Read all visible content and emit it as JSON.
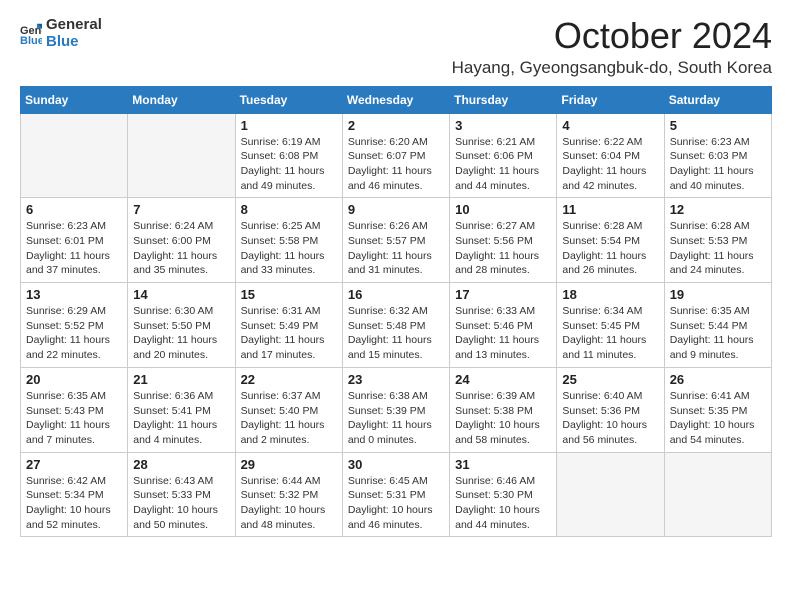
{
  "header": {
    "logo_general": "General",
    "logo_blue": "Blue",
    "title": "October 2024",
    "subtitle": "Hayang, Gyeongsangbuk-do, South Korea"
  },
  "days_of_week": [
    "Sunday",
    "Monday",
    "Tuesday",
    "Wednesday",
    "Thursday",
    "Friday",
    "Saturday"
  ],
  "weeks": [
    [
      {
        "day": "",
        "empty": true
      },
      {
        "day": "",
        "empty": true
      },
      {
        "day": "1",
        "sunrise": "Sunrise: 6:19 AM",
        "sunset": "Sunset: 6:08 PM",
        "daylight": "Daylight: 11 hours and 49 minutes."
      },
      {
        "day": "2",
        "sunrise": "Sunrise: 6:20 AM",
        "sunset": "Sunset: 6:07 PM",
        "daylight": "Daylight: 11 hours and 46 minutes."
      },
      {
        "day": "3",
        "sunrise": "Sunrise: 6:21 AM",
        "sunset": "Sunset: 6:06 PM",
        "daylight": "Daylight: 11 hours and 44 minutes."
      },
      {
        "day": "4",
        "sunrise": "Sunrise: 6:22 AM",
        "sunset": "Sunset: 6:04 PM",
        "daylight": "Daylight: 11 hours and 42 minutes."
      },
      {
        "day": "5",
        "sunrise": "Sunrise: 6:23 AM",
        "sunset": "Sunset: 6:03 PM",
        "daylight": "Daylight: 11 hours and 40 minutes."
      }
    ],
    [
      {
        "day": "6",
        "sunrise": "Sunrise: 6:23 AM",
        "sunset": "Sunset: 6:01 PM",
        "daylight": "Daylight: 11 hours and 37 minutes."
      },
      {
        "day": "7",
        "sunrise": "Sunrise: 6:24 AM",
        "sunset": "Sunset: 6:00 PM",
        "daylight": "Daylight: 11 hours and 35 minutes."
      },
      {
        "day": "8",
        "sunrise": "Sunrise: 6:25 AM",
        "sunset": "Sunset: 5:58 PM",
        "daylight": "Daylight: 11 hours and 33 minutes."
      },
      {
        "day": "9",
        "sunrise": "Sunrise: 6:26 AM",
        "sunset": "Sunset: 5:57 PM",
        "daylight": "Daylight: 11 hours and 31 minutes."
      },
      {
        "day": "10",
        "sunrise": "Sunrise: 6:27 AM",
        "sunset": "Sunset: 5:56 PM",
        "daylight": "Daylight: 11 hours and 28 minutes."
      },
      {
        "day": "11",
        "sunrise": "Sunrise: 6:28 AM",
        "sunset": "Sunset: 5:54 PM",
        "daylight": "Daylight: 11 hours and 26 minutes."
      },
      {
        "day": "12",
        "sunrise": "Sunrise: 6:28 AM",
        "sunset": "Sunset: 5:53 PM",
        "daylight": "Daylight: 11 hours and 24 minutes."
      }
    ],
    [
      {
        "day": "13",
        "sunrise": "Sunrise: 6:29 AM",
        "sunset": "Sunset: 5:52 PM",
        "daylight": "Daylight: 11 hours and 22 minutes."
      },
      {
        "day": "14",
        "sunrise": "Sunrise: 6:30 AM",
        "sunset": "Sunset: 5:50 PM",
        "daylight": "Daylight: 11 hours and 20 minutes."
      },
      {
        "day": "15",
        "sunrise": "Sunrise: 6:31 AM",
        "sunset": "Sunset: 5:49 PM",
        "daylight": "Daylight: 11 hours and 17 minutes."
      },
      {
        "day": "16",
        "sunrise": "Sunrise: 6:32 AM",
        "sunset": "Sunset: 5:48 PM",
        "daylight": "Daylight: 11 hours and 15 minutes."
      },
      {
        "day": "17",
        "sunrise": "Sunrise: 6:33 AM",
        "sunset": "Sunset: 5:46 PM",
        "daylight": "Daylight: 11 hours and 13 minutes."
      },
      {
        "day": "18",
        "sunrise": "Sunrise: 6:34 AM",
        "sunset": "Sunset: 5:45 PM",
        "daylight": "Daylight: 11 hours and 11 minutes."
      },
      {
        "day": "19",
        "sunrise": "Sunrise: 6:35 AM",
        "sunset": "Sunset: 5:44 PM",
        "daylight": "Daylight: 11 hours and 9 minutes."
      }
    ],
    [
      {
        "day": "20",
        "sunrise": "Sunrise: 6:35 AM",
        "sunset": "Sunset: 5:43 PM",
        "daylight": "Daylight: 11 hours and 7 minutes."
      },
      {
        "day": "21",
        "sunrise": "Sunrise: 6:36 AM",
        "sunset": "Sunset: 5:41 PM",
        "daylight": "Daylight: 11 hours and 4 minutes."
      },
      {
        "day": "22",
        "sunrise": "Sunrise: 6:37 AM",
        "sunset": "Sunset: 5:40 PM",
        "daylight": "Daylight: 11 hours and 2 minutes."
      },
      {
        "day": "23",
        "sunrise": "Sunrise: 6:38 AM",
        "sunset": "Sunset: 5:39 PM",
        "daylight": "Daylight: 11 hours and 0 minutes."
      },
      {
        "day": "24",
        "sunrise": "Sunrise: 6:39 AM",
        "sunset": "Sunset: 5:38 PM",
        "daylight": "Daylight: 10 hours and 58 minutes."
      },
      {
        "day": "25",
        "sunrise": "Sunrise: 6:40 AM",
        "sunset": "Sunset: 5:36 PM",
        "daylight": "Daylight: 10 hours and 56 minutes."
      },
      {
        "day": "26",
        "sunrise": "Sunrise: 6:41 AM",
        "sunset": "Sunset: 5:35 PM",
        "daylight": "Daylight: 10 hours and 54 minutes."
      }
    ],
    [
      {
        "day": "27",
        "sunrise": "Sunrise: 6:42 AM",
        "sunset": "Sunset: 5:34 PM",
        "daylight": "Daylight: 10 hours and 52 minutes."
      },
      {
        "day": "28",
        "sunrise": "Sunrise: 6:43 AM",
        "sunset": "Sunset: 5:33 PM",
        "daylight": "Daylight: 10 hours and 50 minutes."
      },
      {
        "day": "29",
        "sunrise": "Sunrise: 6:44 AM",
        "sunset": "Sunset: 5:32 PM",
        "daylight": "Daylight: 10 hours and 48 minutes."
      },
      {
        "day": "30",
        "sunrise": "Sunrise: 6:45 AM",
        "sunset": "Sunset: 5:31 PM",
        "daylight": "Daylight: 10 hours and 46 minutes."
      },
      {
        "day": "31",
        "sunrise": "Sunrise: 6:46 AM",
        "sunset": "Sunset: 5:30 PM",
        "daylight": "Daylight: 10 hours and 44 minutes."
      },
      {
        "day": "",
        "empty": true
      },
      {
        "day": "",
        "empty": true
      }
    ]
  ]
}
